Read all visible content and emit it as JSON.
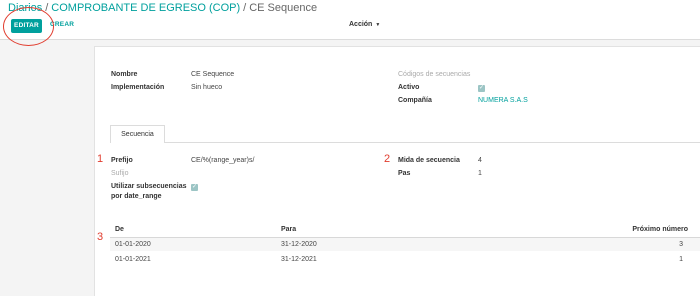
{
  "breadcrumb": {
    "parent": "Diarios",
    "parent2": "COMPROBANTE DE EGRESO (COP)",
    "current": "CE Sequence",
    "separator": "/"
  },
  "toolbar": {
    "edit_label": "EDITAR",
    "create_label": "CREAR",
    "action_label": "Acción"
  },
  "header_fields": {
    "name_label": "Nombre",
    "name_value": "CE Sequence",
    "impl_label": "Implementación",
    "impl_value": "Sin hueco",
    "codes_label": "Códigos de secuencias",
    "active_label": "Activo",
    "active_checked": true,
    "company_label": "Compañía",
    "company_value": "NUMERA S.A.S"
  },
  "tabs": [
    {
      "label": "Secuencia",
      "active": true
    }
  ],
  "sequence_fields": {
    "prefix_label": "Prefijo",
    "prefix_value": "CE/%(range_year)s/",
    "suffix_label": "Sufijo",
    "subseq_label_line1": "Utilizar subsecuencias",
    "subseq_label_line2": "por date_range",
    "subseq_checked": true,
    "size_label": "Mida de secuencia",
    "size_value": "4",
    "step_label": "Pas",
    "step_value": "1"
  },
  "markers": [
    "1",
    "2",
    "3"
  ],
  "date_ranges": {
    "columns": [
      "De",
      "Para",
      "Próximo número"
    ],
    "rows": [
      {
        "from": "01-01-2020",
        "to": "31-12-2020",
        "next": "3"
      },
      {
        "from": "01-01-2021",
        "to": "31-12-2021",
        "next": "1"
      }
    ]
  },
  "colors": {
    "accent": "#00a09d",
    "annotation_red": "#e13c2e"
  }
}
